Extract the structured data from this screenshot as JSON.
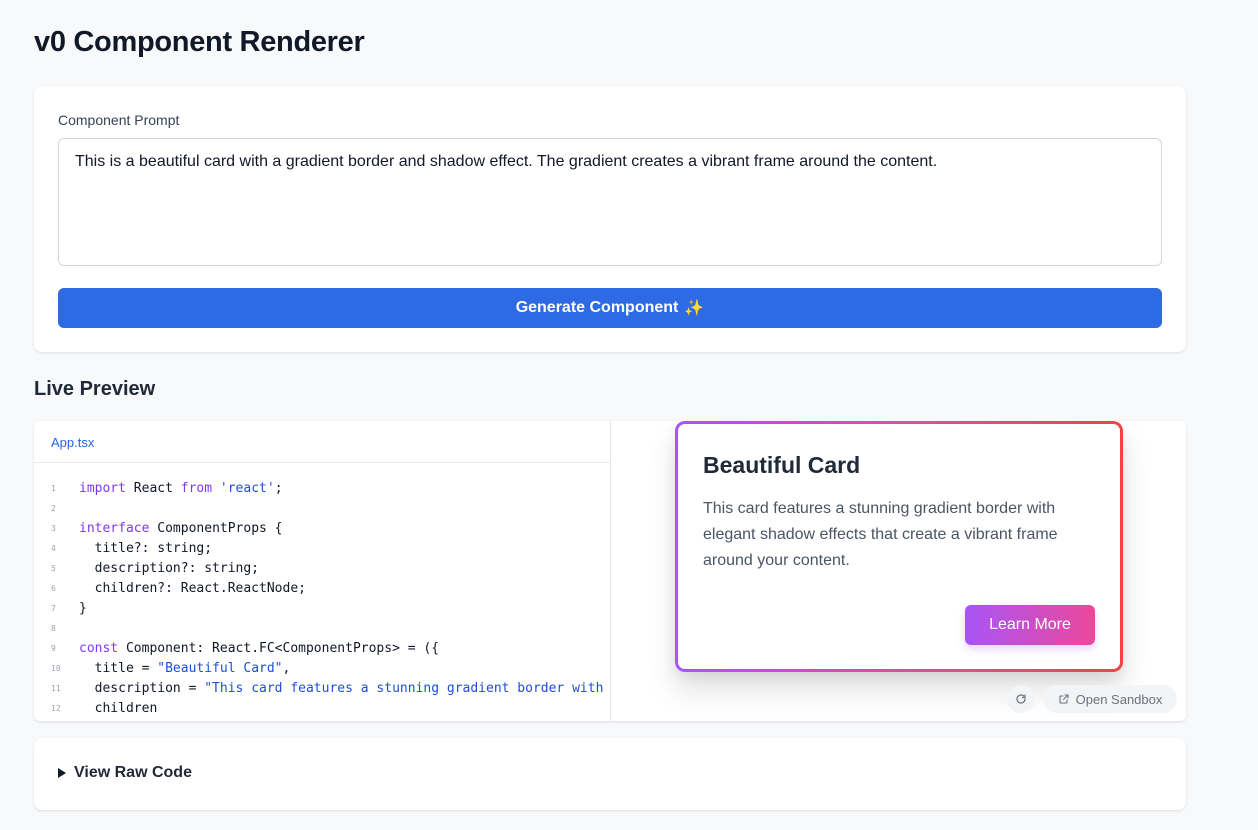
{
  "page": {
    "title": "v0 Component Renderer"
  },
  "prompt": {
    "label": "Component Prompt",
    "value": "This is a beautiful card with a gradient border and shadow effect. The gradient creates a vibrant frame around the content.",
    "generate_label": "Generate Component",
    "generate_icon": "sparkles-icon"
  },
  "preview": {
    "heading": "Live Preview",
    "file_tab": "App.tsx",
    "code_lines": [
      {
        "n": "1",
        "segs": [
          [
            "kw",
            "import"
          ],
          [
            "code",
            " React "
          ],
          [
            "kw",
            "from"
          ],
          [
            "code",
            " "
          ],
          [
            "str",
            "'react'"
          ],
          [
            "code",
            ";"
          ]
        ]
      },
      {
        "n": "2",
        "segs": []
      },
      {
        "n": "3",
        "segs": [
          [
            "kw",
            "interface"
          ],
          [
            "code",
            " ComponentProps {"
          ]
        ]
      },
      {
        "n": "4",
        "segs": [
          [
            "code",
            "  title?: string;"
          ]
        ]
      },
      {
        "n": "5",
        "segs": [
          [
            "code",
            "  description?: string;"
          ]
        ]
      },
      {
        "n": "6",
        "segs": [
          [
            "code",
            "  children?: React.ReactNode;"
          ]
        ]
      },
      {
        "n": "7",
        "segs": [
          [
            "code",
            "}"
          ]
        ]
      },
      {
        "n": "8",
        "segs": []
      },
      {
        "n": "9",
        "segs": [
          [
            "kw",
            "const"
          ],
          [
            "code",
            " Component: React.FC<ComponentProps> = ({"
          ]
        ]
      },
      {
        "n": "10",
        "segs": [
          [
            "code",
            "  title = "
          ],
          [
            "str",
            "\"Beautiful Card\""
          ],
          [
            "code",
            ","
          ]
        ]
      },
      {
        "n": "11",
        "segs": [
          [
            "code",
            "  description = "
          ],
          [
            "str",
            "\"This card features a stunning gradient border with"
          ]
        ]
      },
      {
        "n": "12",
        "segs": [
          [
            "code",
            "  children"
          ]
        ]
      }
    ],
    "card": {
      "title": "Beautiful Card",
      "description": "This card features a stunning gradient border with elegant shadow effects that create a vibrant frame around your content.",
      "button_label": "Learn More",
      "gradient_colors": [
        "#a855f7",
        "#ec4899",
        "#ef4444"
      ]
    },
    "refresh_icon": "refresh-icon",
    "sandbox_label": "Open Sandbox",
    "sandbox_icon": "external-link-icon"
  },
  "raw_code": {
    "label": "View Raw Code"
  },
  "colors": {
    "accent": "#2d6ae3",
    "link": "#2563eb"
  }
}
